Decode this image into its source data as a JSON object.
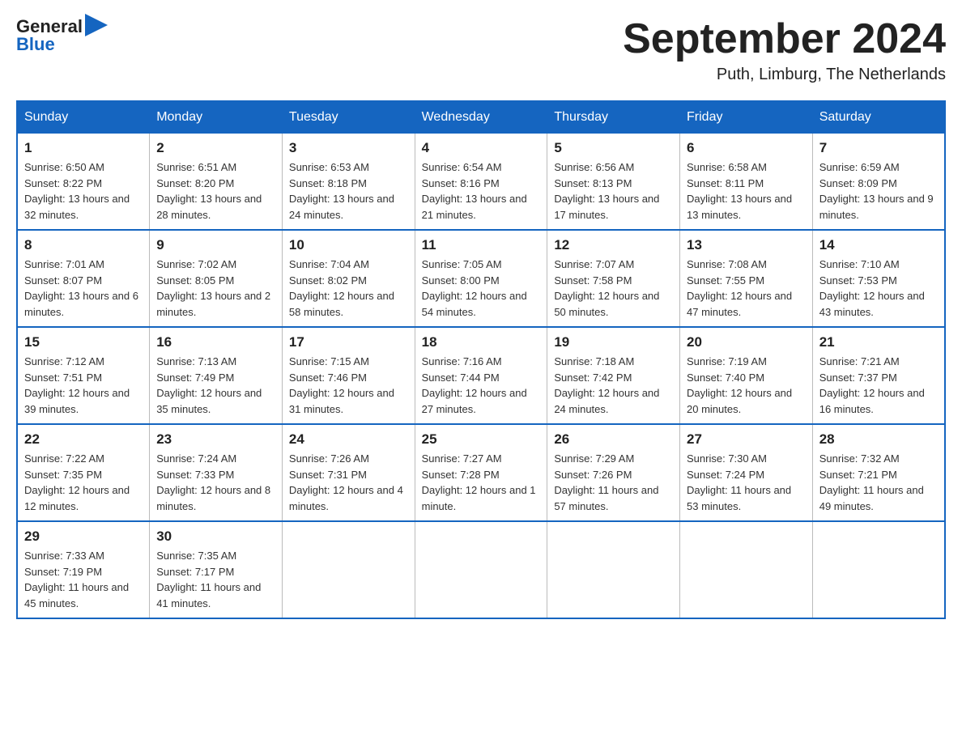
{
  "logo": {
    "general": "General",
    "blue": "Blue"
  },
  "header": {
    "month": "September 2024",
    "location": "Puth, Limburg, The Netherlands"
  },
  "days_of_week": [
    "Sunday",
    "Monday",
    "Tuesday",
    "Wednesday",
    "Thursday",
    "Friday",
    "Saturday"
  ],
  "weeks": [
    [
      {
        "day": "1",
        "sunrise": "6:50 AM",
        "sunset": "8:22 PM",
        "daylight": "13 hours and 32 minutes."
      },
      {
        "day": "2",
        "sunrise": "6:51 AM",
        "sunset": "8:20 PM",
        "daylight": "13 hours and 28 minutes."
      },
      {
        "day": "3",
        "sunrise": "6:53 AM",
        "sunset": "8:18 PM",
        "daylight": "13 hours and 24 minutes."
      },
      {
        "day": "4",
        "sunrise": "6:54 AM",
        "sunset": "8:16 PM",
        "daylight": "13 hours and 21 minutes."
      },
      {
        "day": "5",
        "sunrise": "6:56 AM",
        "sunset": "8:13 PM",
        "daylight": "13 hours and 17 minutes."
      },
      {
        "day": "6",
        "sunrise": "6:58 AM",
        "sunset": "8:11 PM",
        "daylight": "13 hours and 13 minutes."
      },
      {
        "day": "7",
        "sunrise": "6:59 AM",
        "sunset": "8:09 PM",
        "daylight": "13 hours and 9 minutes."
      }
    ],
    [
      {
        "day": "8",
        "sunrise": "7:01 AM",
        "sunset": "8:07 PM",
        "daylight": "13 hours and 6 minutes."
      },
      {
        "day": "9",
        "sunrise": "7:02 AM",
        "sunset": "8:05 PM",
        "daylight": "13 hours and 2 minutes."
      },
      {
        "day": "10",
        "sunrise": "7:04 AM",
        "sunset": "8:02 PM",
        "daylight": "12 hours and 58 minutes."
      },
      {
        "day": "11",
        "sunrise": "7:05 AM",
        "sunset": "8:00 PM",
        "daylight": "12 hours and 54 minutes."
      },
      {
        "day": "12",
        "sunrise": "7:07 AM",
        "sunset": "7:58 PM",
        "daylight": "12 hours and 50 minutes."
      },
      {
        "day": "13",
        "sunrise": "7:08 AM",
        "sunset": "7:55 PM",
        "daylight": "12 hours and 47 minutes."
      },
      {
        "day": "14",
        "sunrise": "7:10 AM",
        "sunset": "7:53 PM",
        "daylight": "12 hours and 43 minutes."
      }
    ],
    [
      {
        "day": "15",
        "sunrise": "7:12 AM",
        "sunset": "7:51 PM",
        "daylight": "12 hours and 39 minutes."
      },
      {
        "day": "16",
        "sunrise": "7:13 AM",
        "sunset": "7:49 PM",
        "daylight": "12 hours and 35 minutes."
      },
      {
        "day": "17",
        "sunrise": "7:15 AM",
        "sunset": "7:46 PM",
        "daylight": "12 hours and 31 minutes."
      },
      {
        "day": "18",
        "sunrise": "7:16 AM",
        "sunset": "7:44 PM",
        "daylight": "12 hours and 27 minutes."
      },
      {
        "day": "19",
        "sunrise": "7:18 AM",
        "sunset": "7:42 PM",
        "daylight": "12 hours and 24 minutes."
      },
      {
        "day": "20",
        "sunrise": "7:19 AM",
        "sunset": "7:40 PM",
        "daylight": "12 hours and 20 minutes."
      },
      {
        "day": "21",
        "sunrise": "7:21 AM",
        "sunset": "7:37 PM",
        "daylight": "12 hours and 16 minutes."
      }
    ],
    [
      {
        "day": "22",
        "sunrise": "7:22 AM",
        "sunset": "7:35 PM",
        "daylight": "12 hours and 12 minutes."
      },
      {
        "day": "23",
        "sunrise": "7:24 AM",
        "sunset": "7:33 PM",
        "daylight": "12 hours and 8 minutes."
      },
      {
        "day": "24",
        "sunrise": "7:26 AM",
        "sunset": "7:31 PM",
        "daylight": "12 hours and 4 minutes."
      },
      {
        "day": "25",
        "sunrise": "7:27 AM",
        "sunset": "7:28 PM",
        "daylight": "12 hours and 1 minute."
      },
      {
        "day": "26",
        "sunrise": "7:29 AM",
        "sunset": "7:26 PM",
        "daylight": "11 hours and 57 minutes."
      },
      {
        "day": "27",
        "sunrise": "7:30 AM",
        "sunset": "7:24 PM",
        "daylight": "11 hours and 53 minutes."
      },
      {
        "day": "28",
        "sunrise": "7:32 AM",
        "sunset": "7:21 PM",
        "daylight": "11 hours and 49 minutes."
      }
    ],
    [
      {
        "day": "29",
        "sunrise": "7:33 AM",
        "sunset": "7:19 PM",
        "daylight": "11 hours and 45 minutes."
      },
      {
        "day": "30",
        "sunrise": "7:35 AM",
        "sunset": "7:17 PM",
        "daylight": "11 hours and 41 minutes."
      },
      null,
      null,
      null,
      null,
      null
    ]
  ]
}
